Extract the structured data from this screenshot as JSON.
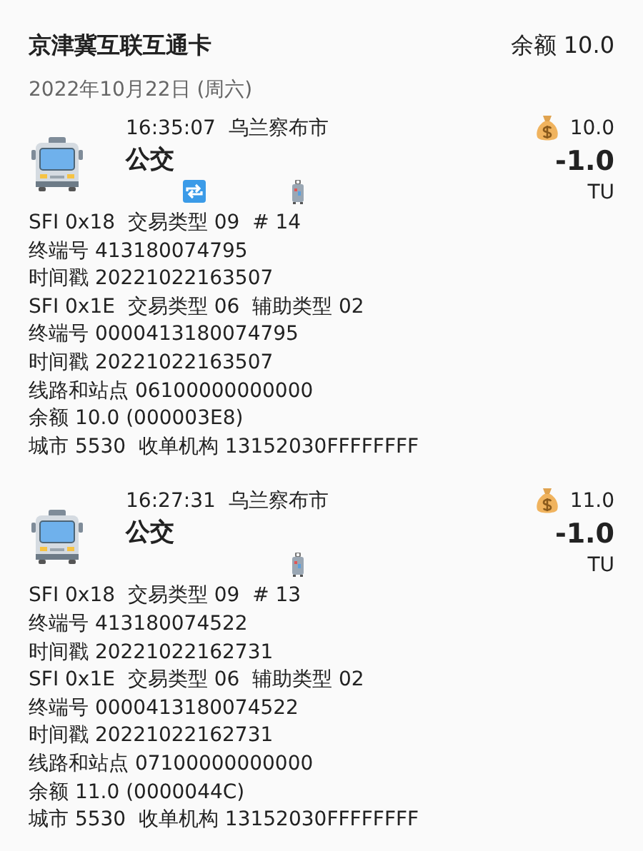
{
  "card": {
    "title": "京津冀互联互通卡",
    "balance": "余额 10.0"
  },
  "date": "2022年10月22日 (周六)",
  "trips": [
    {
      "time": "16:35:07",
      "city": "乌兰察布市",
      "mode": "公交",
      "balance_after": "10.0",
      "amount": "-1.0",
      "currency": "TU",
      "transfer": true,
      "details": [
        "SFI 0x18  交易类型 09  # 14",
        "终端号 413180074795",
        "时间戳 20221022163507",
        "SFI 0x1E  交易类型 06  辅助类型 02",
        "终端号 0000413180074795",
        "时间戳 20221022163507",
        "线路和站点 06100000000000",
        "余额 10.0 (000003E8)",
        "城市 5530  收单机构 13152030FFFFFFFF"
      ]
    },
    {
      "time": "16:27:31",
      "city": "乌兰察布市",
      "mode": "公交",
      "balance_after": "11.0",
      "amount": "-1.0",
      "currency": "TU",
      "transfer": false,
      "details": [
        "SFI 0x18  交易类型 09  # 13",
        "终端号 413180074522",
        "时间戳 20221022162731",
        "SFI 0x1E  交易类型 06  辅助类型 02",
        "终端号 0000413180074522",
        "时间戳 20221022162731",
        "线路和站点 07100000000000",
        "余额 11.0 (0000044C)",
        "城市 5530  收单机构 13152030FFFFFFFF"
      ]
    }
  ]
}
